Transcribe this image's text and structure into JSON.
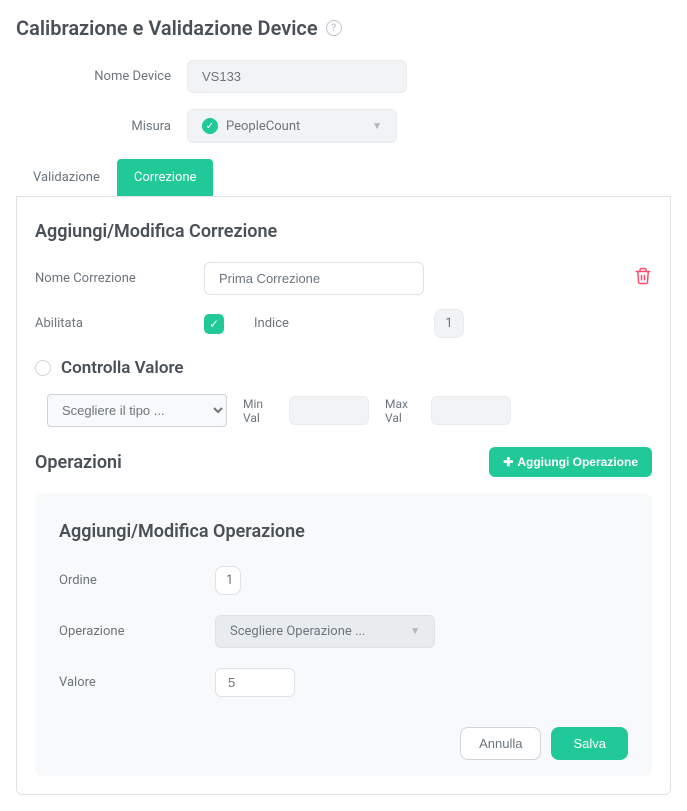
{
  "page": {
    "title": "Calibrazione e Validazione Device"
  },
  "device": {
    "name_label": "Nome Device",
    "name_value": "VS133",
    "measure_label": "Misura",
    "measure_value": "PeopleCount"
  },
  "tabs": {
    "validation": "Validazione",
    "correction": "Correzione"
  },
  "correction": {
    "section_title": "Aggiungi/Modifica Correzione",
    "name_label": "Nome Correzione",
    "name_value": "Prima Correzione",
    "enabled_label": "Abilitata",
    "index_label": "Indice",
    "index_value": "1"
  },
  "check_value": {
    "title": "Controlla Valore",
    "type_placeholder": "Scegliere il tipo ...",
    "min_label": "Min Val",
    "max_label": "Max Val"
  },
  "operations": {
    "title": "Operazioni",
    "add_button": "Aggiungi Operazione"
  },
  "operation_form": {
    "title": "Aggiungi/Modifica Operazione",
    "order_label": "Ordine",
    "order_value": "1",
    "operation_label": "Operazione",
    "operation_placeholder": "Scegliere Operazione ...",
    "value_label": "Valore",
    "value_value": "5",
    "cancel": "Annulla",
    "save": "Salva"
  }
}
